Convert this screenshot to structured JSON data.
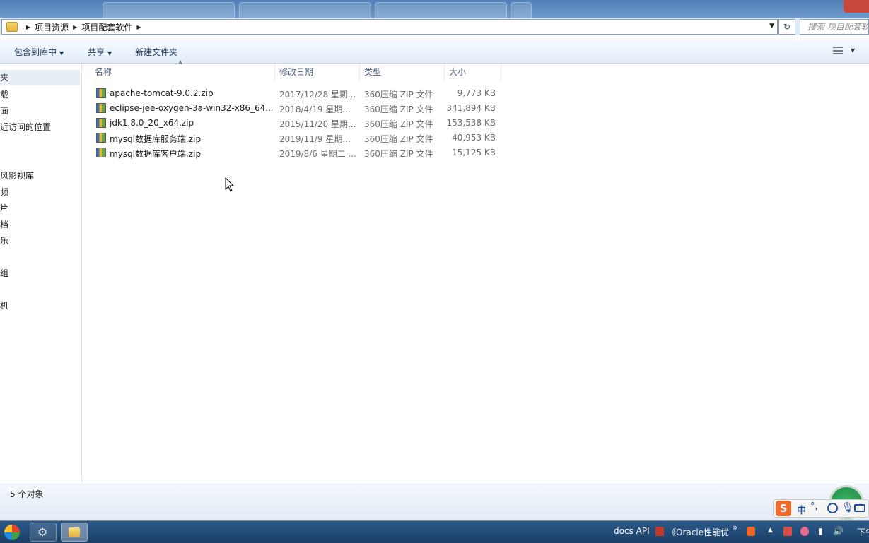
{
  "address": {
    "crumbs": [
      "项目资源",
      "项目配套软件"
    ],
    "search_placeholder": "搜索 项目配套软"
  },
  "toolbar": {
    "include_in_library": "包含到库中",
    "share": "共享",
    "new_folder": "新建文件夹"
  },
  "nav": {
    "items": [
      "夹",
      "载",
      "面",
      "近访问的位置",
      "风影视库",
      "频",
      "片",
      "档",
      "乐",
      "组",
      "机"
    ]
  },
  "list": {
    "columns": {
      "name": "名称",
      "date": "修改日期",
      "type": "类型",
      "size": "大小"
    },
    "rows": [
      {
        "name": "apache-tomcat-9.0.2.zip",
        "date": "2017/12/28 星期...",
        "type": "360压缩 ZIP 文件",
        "size": "9,773 KB"
      },
      {
        "name": "eclipse-jee-oxygen-3a-win32-x86_64....",
        "date": "2018/4/19 星期...",
        "type": "360压缩 ZIP 文件",
        "size": "341,894 KB"
      },
      {
        "name": "jdk1.8.0_20_x64.zip",
        "date": "2015/11/20 星期...",
        "type": "360压缩 ZIP 文件",
        "size": "153,538 KB"
      },
      {
        "name": "mysql数据库服务端.zip",
        "date": "2019/11/9 星期...",
        "type": "360压缩 ZIP 文件",
        "size": "40,953 KB"
      },
      {
        "name": "mysql数据库客户端.zip",
        "date": "2019/8/6 星期二 ...",
        "type": "360压缩 ZIP 文件",
        "size": "15,125 KB"
      }
    ]
  },
  "status": {
    "count_text": "5 个对象"
  },
  "ime": {
    "logo": "S",
    "mode": "中",
    "punct": "°,"
  },
  "taskbar": {
    "docs_api": "docs API",
    "oracle_doc": "《Oracle性能优",
    "more": "»",
    "clock_fragment": "下午"
  }
}
